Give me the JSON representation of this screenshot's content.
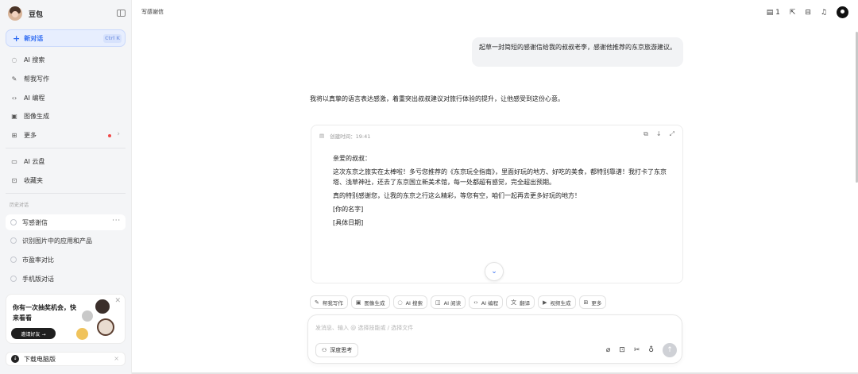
{
  "sidebar": {
    "app_name": "豆包",
    "new_chat": {
      "label": "新对话",
      "shortcut": "Ctrl K"
    },
    "nav": [
      {
        "icon": "search-icon",
        "label": "AI 搜索"
      },
      {
        "icon": "pen-icon",
        "label": "帮我写作"
      },
      {
        "icon": "code-icon",
        "label": "AI 编程"
      },
      {
        "icon": "image-icon",
        "label": "图像生成"
      },
      {
        "icon": "grid-icon",
        "label": "更多"
      }
    ],
    "nav2": [
      {
        "icon": "cloud-drive-icon",
        "label": "AI 云盘"
      },
      {
        "icon": "bookmark-icon",
        "label": "收藏夹"
      }
    ],
    "history_label": "历史对话",
    "history": [
      {
        "label": "写感谢信"
      },
      {
        "label": "识别图片中的应用和产品"
      },
      {
        "label": "市盈率对比"
      },
      {
        "label": "手机版对话"
      }
    ],
    "promo": {
      "title": "你有一次抽奖机会，快来看看",
      "button": "邀请好友 →"
    },
    "download": "下载电脑版"
  },
  "main": {
    "title": "写感谢信",
    "share_count": "1",
    "user_message": "起草一封简短的感谢信给我的叔叔老李，感谢他推荐的东京旅游建议。",
    "ai_intro": "我将以真挚的语言表达感激，着重突出叔叔建议对旅行体验的提升，让他感受到这份心意。",
    "card": {
      "created": "创建时间：19:41",
      "paragraphs": [
        "亲爱的叔叔：",
        "这次东京之旅实在太棒啦！多亏您推荐的《东京玩全指南》，里面好玩的地方、好吃的美食，都特别靠谱！我打卡了东京塔、浅草神社，还去了东京国立新美术馆，每一处都超有感觉，完全超出预期。",
        "真的特别感谢您，让我的东京之行这么精彩，等您有空，咱们一起再去更多好玩的地方！",
        "[你的名字]",
        "[具体日期]"
      ]
    },
    "skills": [
      {
        "icon": "pen-icon",
        "label": "帮我写作"
      },
      {
        "icon": "image-icon",
        "label": "图像生成"
      },
      {
        "icon": "search-icon",
        "label": "AI 搜索"
      },
      {
        "icon": "read-icon",
        "label": "AI 阅读"
      },
      {
        "icon": "code-icon",
        "label": "AI 编程"
      },
      {
        "icon": "translate-icon",
        "label": "翻译"
      },
      {
        "icon": "video-icon",
        "label": "视频生成"
      },
      {
        "icon": "grid-icon",
        "label": "更多"
      }
    ],
    "composer": {
      "placeholder": "发消息、输入 @ 选择技能或 / 选择文件",
      "deep_think": "深度思考"
    }
  }
}
